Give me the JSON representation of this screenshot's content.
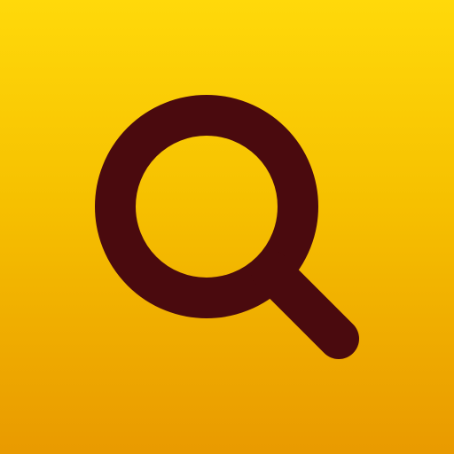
{
  "app": {
    "icon": "search-icon",
    "colors": {
      "background_top": "#ffd90a",
      "background_mid": "#f6c000",
      "background_bottom": "#e99a00",
      "glyph": "#4a0a0e"
    }
  }
}
